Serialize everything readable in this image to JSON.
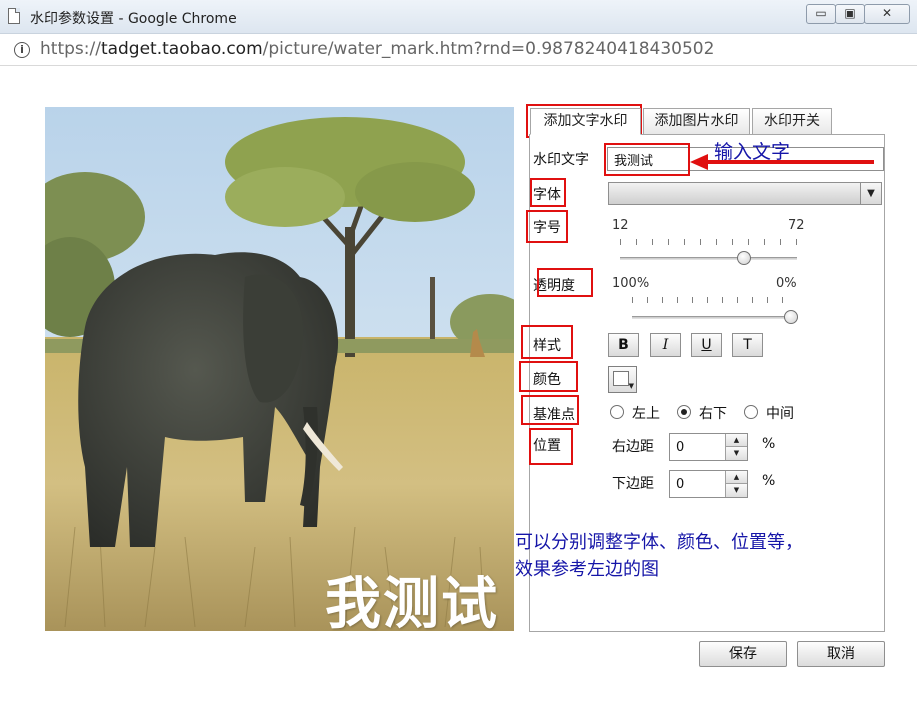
{
  "window": {
    "title": "水印参数设置 - Google Chrome",
    "minimize_symbol": "▭",
    "maximize_symbol": "▣",
    "close_symbol": "✕"
  },
  "address": {
    "info_symbol": "i",
    "scheme": "https://",
    "host": "tadget.taobao.com",
    "path": "/picture/water_mark.htm?rnd=0.9878240418430502"
  },
  "preview": {
    "watermark_text": "我测试"
  },
  "tabs": [
    {
      "label": "添加文字水印",
      "active": true
    },
    {
      "label": "添加图片水印",
      "active": false
    },
    {
      "label": "水印开关",
      "active": false
    }
  ],
  "form": {
    "watermark_text_label": "水印文字",
    "watermark_text_value": "我测试",
    "font_label": "字体",
    "font_value": "",
    "size_label": "字号",
    "size_min": "12",
    "size_max": "72",
    "size_level": 0.7,
    "opacity_label": "透明度",
    "opacity_min": "100%",
    "opacity_max": "0%",
    "opacity_level": 1.0,
    "style_label": "样式",
    "style_buttons": {
      "bold": "B",
      "italic": "I",
      "underline": "U",
      "clear": "T"
    },
    "color_label": "颜色",
    "color_value": "#ffffff",
    "anchor_label": "基准点",
    "anchor_options": [
      "左上",
      "右下",
      "中间"
    ],
    "anchor_selected": "右下",
    "position_label": "位置",
    "right_margin_label": "右边距",
    "right_margin_value": "0",
    "bottom_margin_label": "下边距",
    "bottom_margin_value": "0",
    "percent_unit": "%",
    "spin_up": "▲",
    "spin_down": "▼",
    "dropdown_arrow": "▼"
  },
  "annotations": {
    "input_hint": "输入文字",
    "help_line1": "可以分别调整字体、颜色、位置等，",
    "help_line2": "效果参考左边的图",
    "highlight_color": "#e01010"
  },
  "buttons": {
    "save": "保存",
    "cancel": "取消"
  }
}
